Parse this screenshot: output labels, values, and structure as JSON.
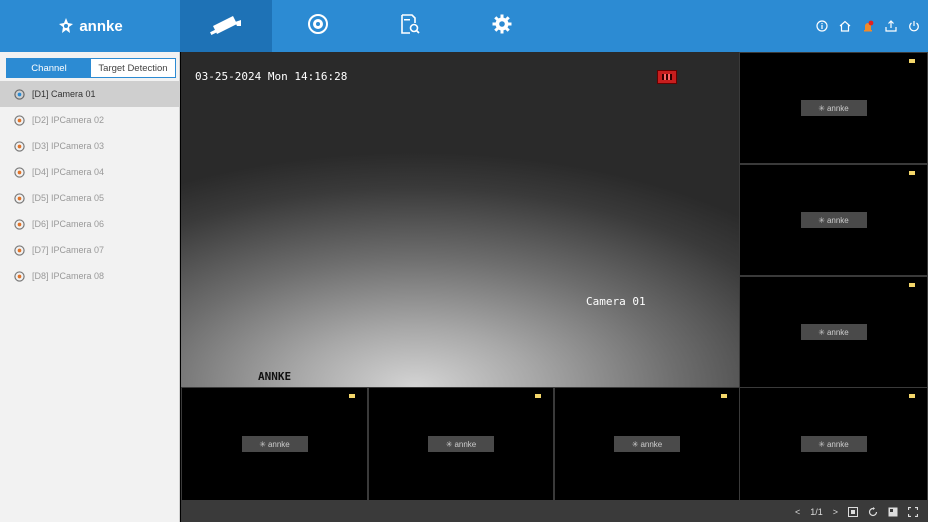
{
  "app": {
    "brand": "annke"
  },
  "nav": {
    "tabs": [
      {
        "name": "live-view",
        "icon": "camera-icon",
        "active": true
      },
      {
        "name": "playback",
        "icon": "playback-icon",
        "active": false
      },
      {
        "name": "search",
        "icon": "file-search-icon",
        "active": false
      },
      {
        "name": "settings",
        "icon": "gear-icon",
        "active": false
      }
    ],
    "right_icons": [
      "info-icon",
      "home-icon",
      "alarm-icon",
      "export-icon",
      "power-icon"
    ]
  },
  "left_panel": {
    "tabs": [
      {
        "label": "Channel",
        "active": true
      },
      {
        "label": "Target Detection",
        "active": false
      }
    ],
    "cameras": [
      {
        "label": "[D1] Camera 01",
        "selected": true
      },
      {
        "label": "[D2] IPCamera 02",
        "selected": false
      },
      {
        "label": "[D3] IPCamera 03",
        "selected": false
      },
      {
        "label": "[D4] IPCamera 04",
        "selected": false
      },
      {
        "label": "[D5] IPCamera 05",
        "selected": false
      },
      {
        "label": "[D6] IPCamera 06",
        "selected": false
      },
      {
        "label": "[D7] IPCamera 07",
        "selected": false
      },
      {
        "label": "[D8] IPCamera 08",
        "selected": false
      }
    ]
  },
  "main_view": {
    "timestamp": "03-25-2024 Mon 14:16:28",
    "camera_name": "Camera 01",
    "brand_overlay": "ANNKE"
  },
  "tiles": {
    "placeholder": "annke"
  },
  "bottom_bar": {
    "page": "1/1"
  },
  "colors": {
    "accent": "#2c8bd3",
    "panel": "#f2f2f2",
    "selected_row": "#cfcfcf",
    "flag": "#f3d66a"
  }
}
